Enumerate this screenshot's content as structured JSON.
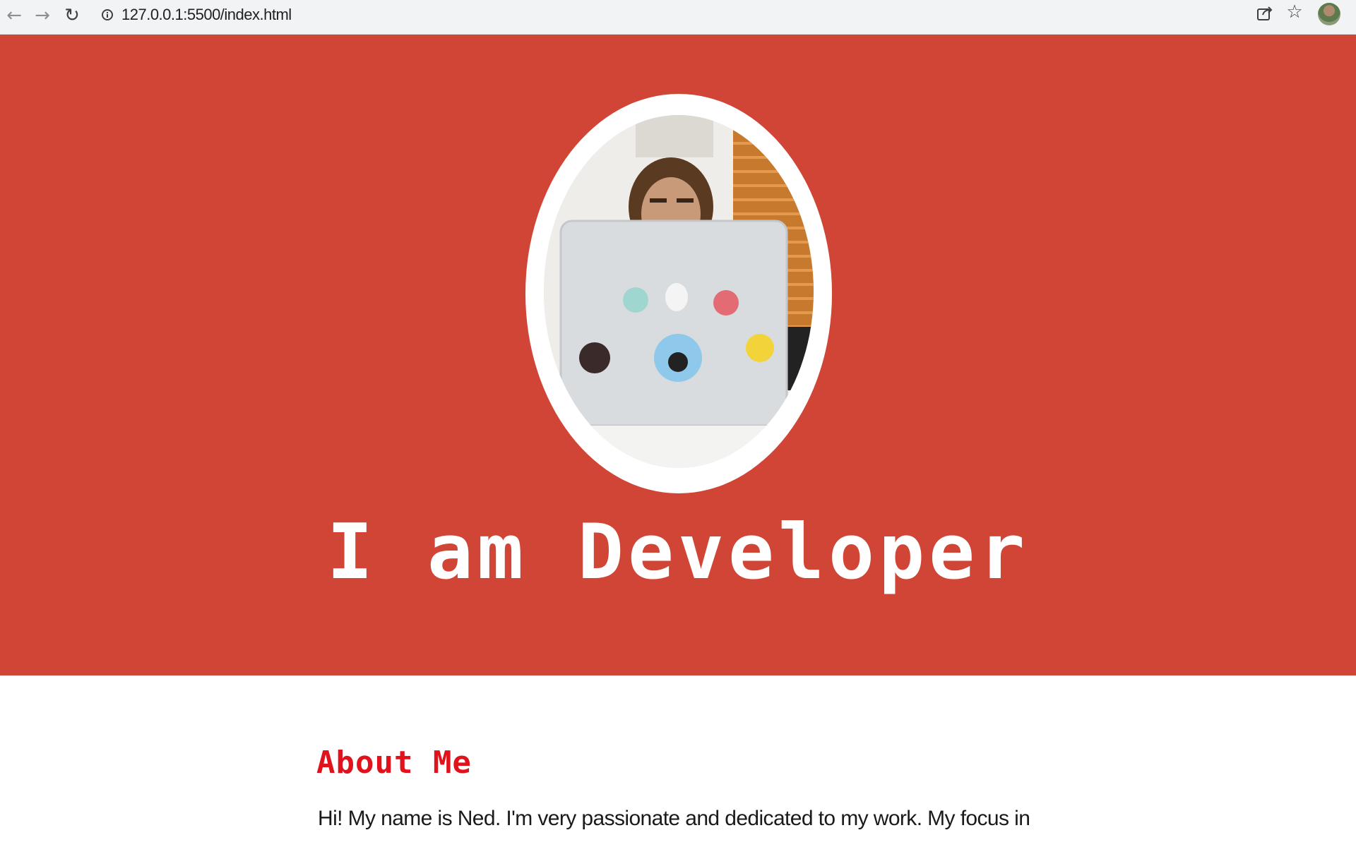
{
  "browser": {
    "back_icon": "arrow-left-icon",
    "forward_icon": "arrow-right-icon",
    "reload_icon": "reload-icon",
    "url": "127.0.0.1:5500/index.html",
    "share_icon": "share-icon",
    "bookmark_icon": "star-icon",
    "profile_icon": "avatar"
  },
  "hero": {
    "background_color": "#d04536",
    "photo_description_icon": "developer-photo",
    "title": "I am Developer"
  },
  "about": {
    "heading": "About Me",
    "heading_color": "#e0121c",
    "text": "Hi! My name is Ned. I'm very passionate and dedicated to my work. My focus in"
  }
}
